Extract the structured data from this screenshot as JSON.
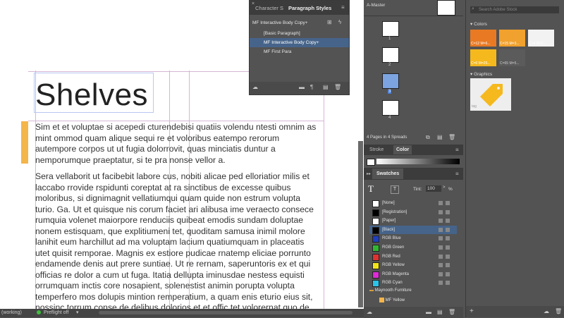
{
  "document": {
    "title": "Shelves",
    "paragraph1": "Sim et et voluptae si acepedi cturendebisi quatiis volendu ntesti omnim as mint ommod quam alique sequi re et voloribus eatempo rerorum autempore corpos ut ut fugia dolorrovit, quas minciatis duntur a nemporumque praeptatur, si te pra nonse vellor a.",
    "paragraph2": "Sera vellaborit ut facibebit labore cus, nobiti alicae ped elloriatior milis et laccabo rrovide rspidunti coreptat at ra sinctibus de excesse quibus moloribus, si dignimagnit vellatiumqui quam quide non estrum volupta turio. Ga. Ut et quisque nis corum faciet ari alibusa ime veraecto consece rumquia volenet maiorpore renduciis quibeat emodis sundam doluptae nonem estisquam, que explitiumeni tet, quoditam samusa inimil molore lanihit eum harchillut ad ma voluptam lacium quatiumquam in placeatis utet quisit remporae. Magnis ex estiore pudicae rnatemp eliciae porrunto endamende denis aut prere suntiae. Ut re rernam, saperuntoris ex et qui officias re dolor a cum ut fuga. Itatia dellupta iminusdae nestess equisti orrumquam inctis core nosapient, solenestist animin porupta volupta temperfero mos dolupis mintion remperatium, a quam enis eturio eius sit, nossinc torrum conse de delibus dolorios et et offic tet volorernat quo de"
  },
  "status": {
    "working": "(working)",
    "preflight": "Preflight off"
  },
  "paragraph_styles_panel": {
    "tab_character": "Character S",
    "tab_paragraph": "Paragraph Styles",
    "current_style": "MF Interactive Body Copy+",
    "items": [
      "[Basic Paragraph]",
      "MF Interactive Body Copy+",
      "MF First Para"
    ]
  },
  "pages_panel": {
    "master": "A-Master",
    "page_numbers": [
      "1",
      "2",
      "3",
      "4"
    ],
    "summary": "4 Pages in 4 Spreads"
  },
  "stroke_color_panel": {
    "tab_stroke": "Stroke",
    "tab_color": "Color"
  },
  "swatches_panel": {
    "tab": "Swatches",
    "tint_label": "Tint:",
    "tint_value": "100",
    "tint_unit": "%",
    "items": [
      {
        "name": "[None]",
        "color": "#ffffff"
      },
      {
        "name": "[Registration]",
        "color": "#000000"
      },
      {
        "name": "[Paper]",
        "color": "#ffffff"
      },
      {
        "name": "[Black]",
        "color": "#000000"
      },
      {
        "name": "RGB Blue",
        "color": "#1f3fbf"
      },
      {
        "name": "RGB Green",
        "color": "#2fb82f"
      },
      {
        "name": "RGB Red",
        "color": "#e03131"
      },
      {
        "name": "RGB Yellow",
        "color": "#f2e31a"
      },
      {
        "name": "RGB Magenta",
        "color": "#e02ad8"
      },
      {
        "name": "RGB Cyan",
        "color": "#2ac4ea"
      }
    ],
    "group": "Maynooth Furniture",
    "group_item": "MF Yellow"
  },
  "libraries_panel": {
    "search_placeholder": "Search Adobe Stock",
    "colors_heading": "Colors",
    "graphics_heading": "Graphics",
    "graphic_caption": "tag",
    "colors": [
      {
        "label": "C=12 M=6...",
        "color": "#e97a23"
      },
      {
        "label": "C=15 M=3...",
        "color": "#f0a12e"
      },
      {
        "label": "C=4 M=2...",
        "color": "#f2f2f2"
      },
      {
        "label": "C=0 M=25...",
        "color": "#f5b91e"
      },
      {
        "label": "C=65 M=5...",
        "color": "#5b5b5b"
      }
    ]
  }
}
